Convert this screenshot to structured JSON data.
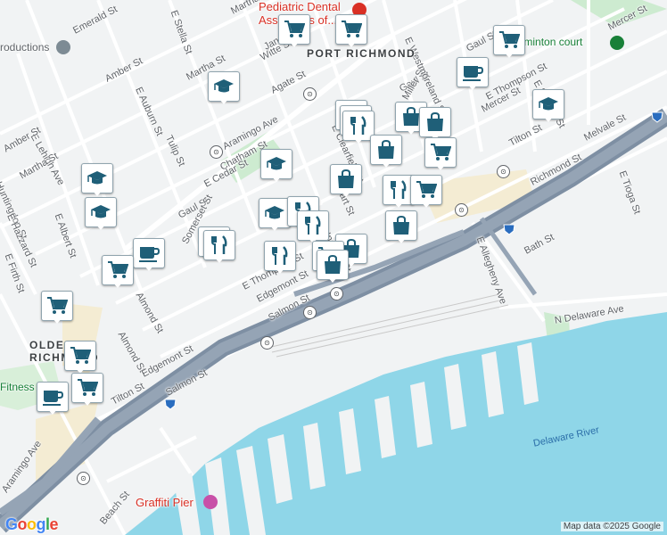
{
  "place_labels": {
    "port_richmond": "PORT RICHMOND",
    "olde_richmond": "OLDE\nRICHMOND"
  },
  "street_labels": [
    "Emerald St",
    "Amber St",
    "E Auburn St",
    "Martha St",
    "Tulip St",
    "Agate St",
    "Aramingo Ave",
    "Chatham St",
    "E Cedar St",
    "Gaul St",
    "Somerset St",
    "Almond St",
    "E Lehigh Ave",
    "Huntingdon St",
    "E Hazzard St",
    "E Albert St",
    "E Firth St",
    "Amber St",
    "Martha St",
    "E Thompson St",
    "Edgemont St",
    "Salmon St",
    "Almond St",
    "Tilton St",
    "Edgemont St",
    "Salmon St",
    "Witte St",
    "Janney St",
    "E Stella St",
    "Martha St",
    "Gaul St",
    "Miller St",
    "E Westmoreland St",
    "Richmond St",
    "Mercer St",
    "E Thompson St",
    "E Schiller St",
    "Tilton St",
    "Melvale St",
    "E Tioga St",
    "E Allegheny Ave",
    "Bath St",
    "N Delaware Ave",
    "Beach St",
    "Aramingo Ave",
    "Mercer St",
    "Gaul St",
    "E Indiana St",
    "E Clearfield St",
    "E Hart St"
  ],
  "pois": {
    "pediatric": "Pediatric Dental\nAssociates of...",
    "badminton": "Badminton court",
    "fitness": "Fitness",
    "graffiti": "Graffiti Pier",
    "productions": "roductions"
  },
  "water_labels": {
    "delaware": "Delaware River"
  },
  "highway_shield": "95",
  "transit_symbol": "⊙",
  "attribution": "Map data ©2025 Google",
  "logo": "Google",
  "marker_icons": [
    "shopping-cart-icon",
    "coffee-cup-icon",
    "graduation-cap-icon",
    "fork-knife-icon",
    "shopping-bag-icon"
  ],
  "colors": {
    "land": "#f1f3f4",
    "water": "#8fd6e8",
    "highway": "#7e8fa3",
    "park": "#cdebd0",
    "sand": "#f4ecd3",
    "marker_icon": "#1f5f78"
  }
}
